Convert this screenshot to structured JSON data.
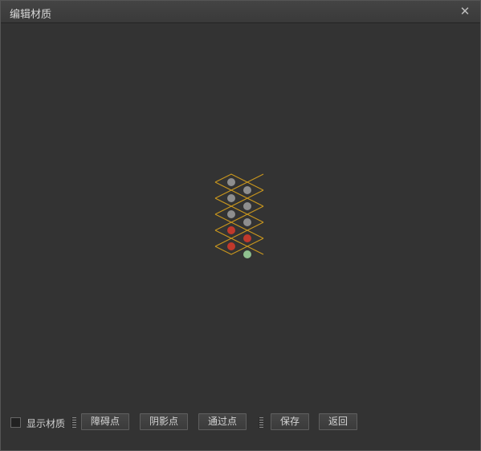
{
  "window": {
    "title": "编辑材质",
    "close_label": "✕"
  },
  "toolbar": {
    "show_material_label": "显示材质",
    "show_material_checked": false,
    "buttons": {
      "obstacle": "障碍点",
      "shadow": "阴影点",
      "pass": "通过点",
      "save": "保存",
      "back": "返回"
    }
  },
  "colors": {
    "window_bg": "#333333",
    "grid_line": "#c8961e",
    "point_normal": "#8e8e8e",
    "point_obstacle": "#c0392b",
    "point_pass": "#8fc08f"
  }
}
